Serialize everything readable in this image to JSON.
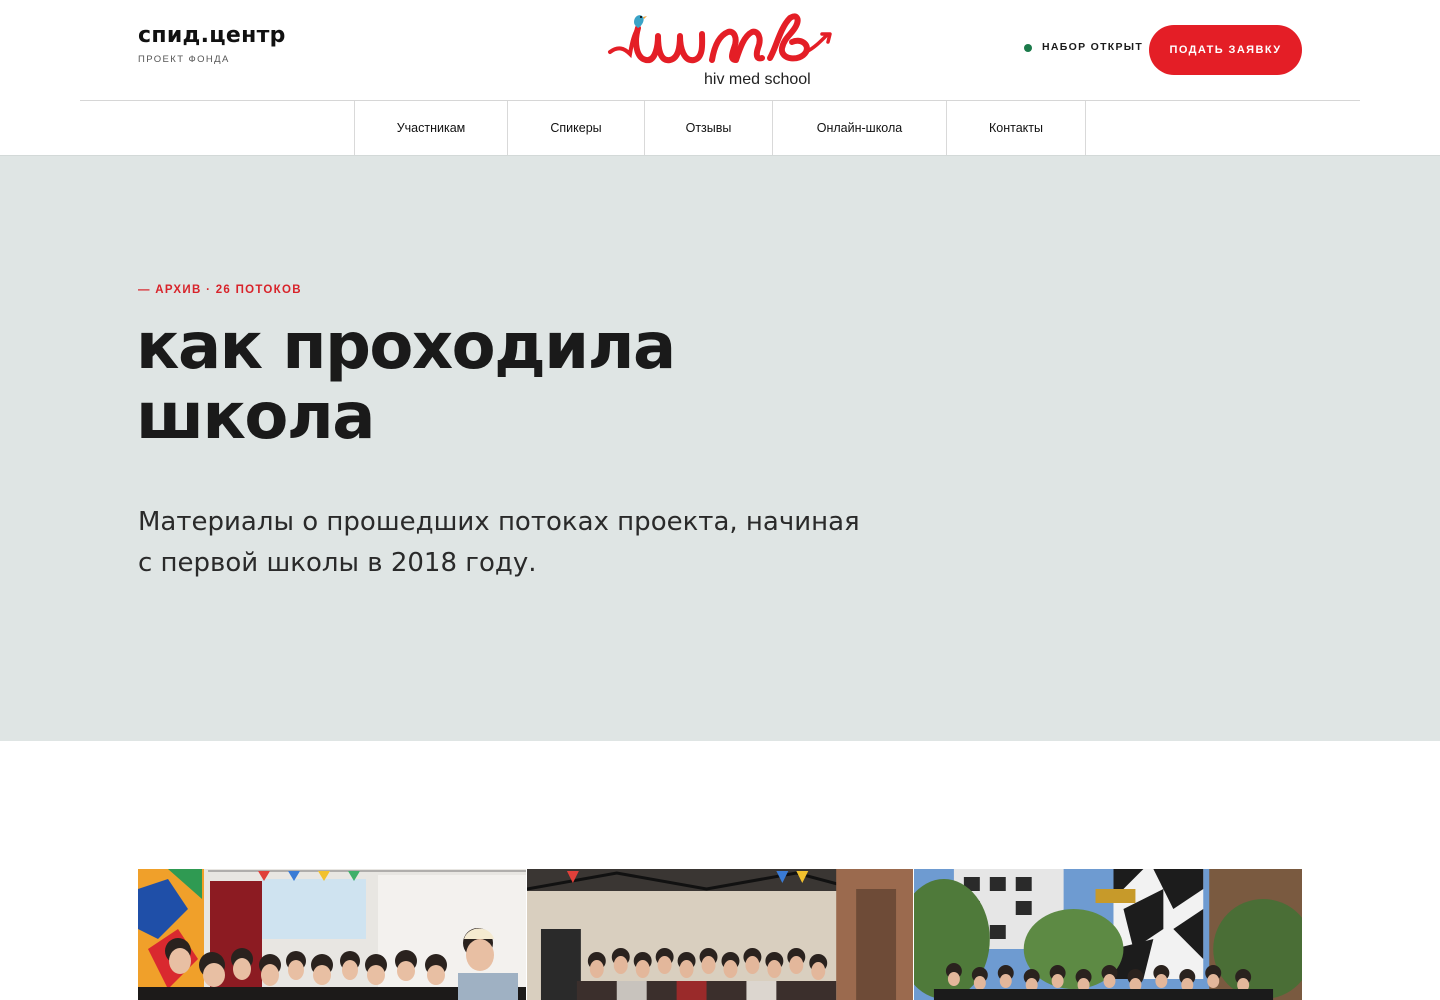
{
  "header": {
    "brand_name": "спид.центр",
    "brand_subtitle": "ПРОЕКТ ФОНДА",
    "logo_text": "шмв",
    "logo_subtitle": "hiv med school",
    "status_text": "НАБОР ОТКРЫТ",
    "status_color": "#1b7a4a",
    "apply_button": "ПОДАТЬ ЗАЯВКУ",
    "accent_color": "#e41e26"
  },
  "nav": {
    "items": [
      {
        "label": "Участникам"
      },
      {
        "label": "Спикеры"
      },
      {
        "label": "Отзывы"
      },
      {
        "label": "Онлайн-школа"
      },
      {
        "label": "Контакты"
      }
    ]
  },
  "hero": {
    "eyebrow": "— АРХИВ · 26 ПОТОКОВ",
    "title_line1": "как проходила",
    "title_line2": "школа",
    "description_line1": "Материалы о прошедших потоках проекта, начиная",
    "description_line2": "с первой школы в 2018 году.",
    "background": "#dfe5e4"
  },
  "photos": [
    {
      "icon": "group-photo-icon"
    },
    {
      "icon": "group-photo-icon"
    },
    {
      "icon": "group-photo-icon"
    }
  ]
}
